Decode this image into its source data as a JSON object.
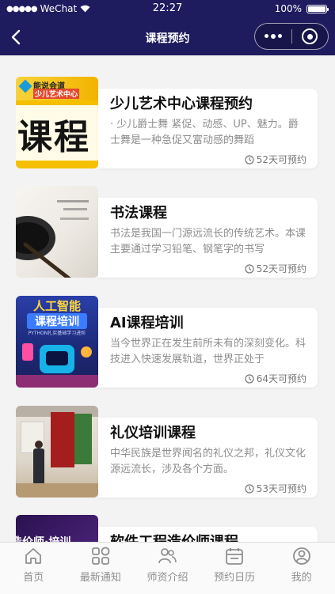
{
  "status_bar": {
    "carrier": "WeChat",
    "time": "22:27",
    "battery": "100%"
  },
  "nav": {
    "title": "课程预约"
  },
  "courses": [
    {
      "title": "少儿艺术中心课程预约",
      "desc": "· 少儿爵士舞 紧促、动感、UP、魅力。爵士舞是一种急促又富动感的舞蹈",
      "days": "52天可预约",
      "thumb_banner": "能说会道",
      "thumb_sub": "少儿艺术中心",
      "thumb_text": "课程"
    },
    {
      "title": "书法课程",
      "desc": "书法是我国一门源远流长的传统艺术。本课主要通过学习铅笔、钢笔字的书写",
      "days": "52天可预约"
    },
    {
      "title": "AI课程培训",
      "desc": "当今世界正在发生前所未有的深刻变化。科技进入快速发展轨道，世界正处于",
      "days": "64天可预约",
      "thumb_line1": "人工智能",
      "thumb_line2": "课程培训",
      "thumb_sub": "PYTHON扎实基础学习进阶"
    },
    {
      "title": "礼仪培训课程",
      "desc": "中华民族是世界闻名的礼仪之邦，礼仪文化源远流长，涉及各个方面。",
      "days": "53天可预约"
    },
    {
      "title": "软件工程造价师课程",
      "desc": "",
      "days": "",
      "thumb_text": "造价师·培训"
    }
  ],
  "tabs": [
    {
      "label": "首页",
      "icon": "home-icon"
    },
    {
      "label": "最新通知",
      "icon": "grid-icon"
    },
    {
      "label": "师资介绍",
      "icon": "teachers-icon"
    },
    {
      "label": "预约日历",
      "icon": "calendar-icon"
    },
    {
      "label": "我的",
      "icon": "profile-icon"
    }
  ],
  "colors": {
    "header": "#1e1b5e",
    "background": "#f3f3f3",
    "tab_inactive": "#8f8f8f"
  }
}
